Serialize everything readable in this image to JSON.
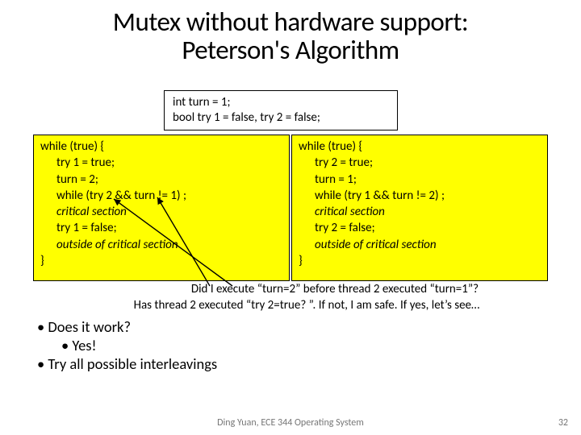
{
  "title_line1": "Mutex without hardware support:",
  "title_line2": "Peterson's Algorithm",
  "shared": {
    "line1": "int turn = 1;",
    "line2": "bool try 1 = false, try 2 = false;"
  },
  "left_code": {
    "l0": "while (true) {",
    "l1": "try 1 = true;",
    "l2": "turn = 2;",
    "l3": "while (try 2 && turn != 1) ;",
    "l4": "critical section",
    "l5": "try 1 = false;",
    "l6": "outside of critical section",
    "l7": "}"
  },
  "right_code": {
    "l0": "while (true) {",
    "l1": "try 2 = true;",
    "l2": "turn = 1;",
    "l3": "while (try 1 && turn != 2) ;",
    "l4": "critical section",
    "l5": "try 2 = false;",
    "l6": "outside of critical section",
    "l7": "}"
  },
  "annotation": {
    "line1": "Did I execute “turn=2” before thread 2 executed “turn=1”?",
    "line2": "Has thread 2 executed “try 2=true? ”. If not, I am safe. If yes, let’s see…"
  },
  "bullets": {
    "b1": "Does it work?",
    "b2": "Yes!",
    "b3": "Try all possible interleavings"
  },
  "footer": {
    "center": "Ding Yuan, ECE 344 Operating System",
    "page": "32"
  }
}
